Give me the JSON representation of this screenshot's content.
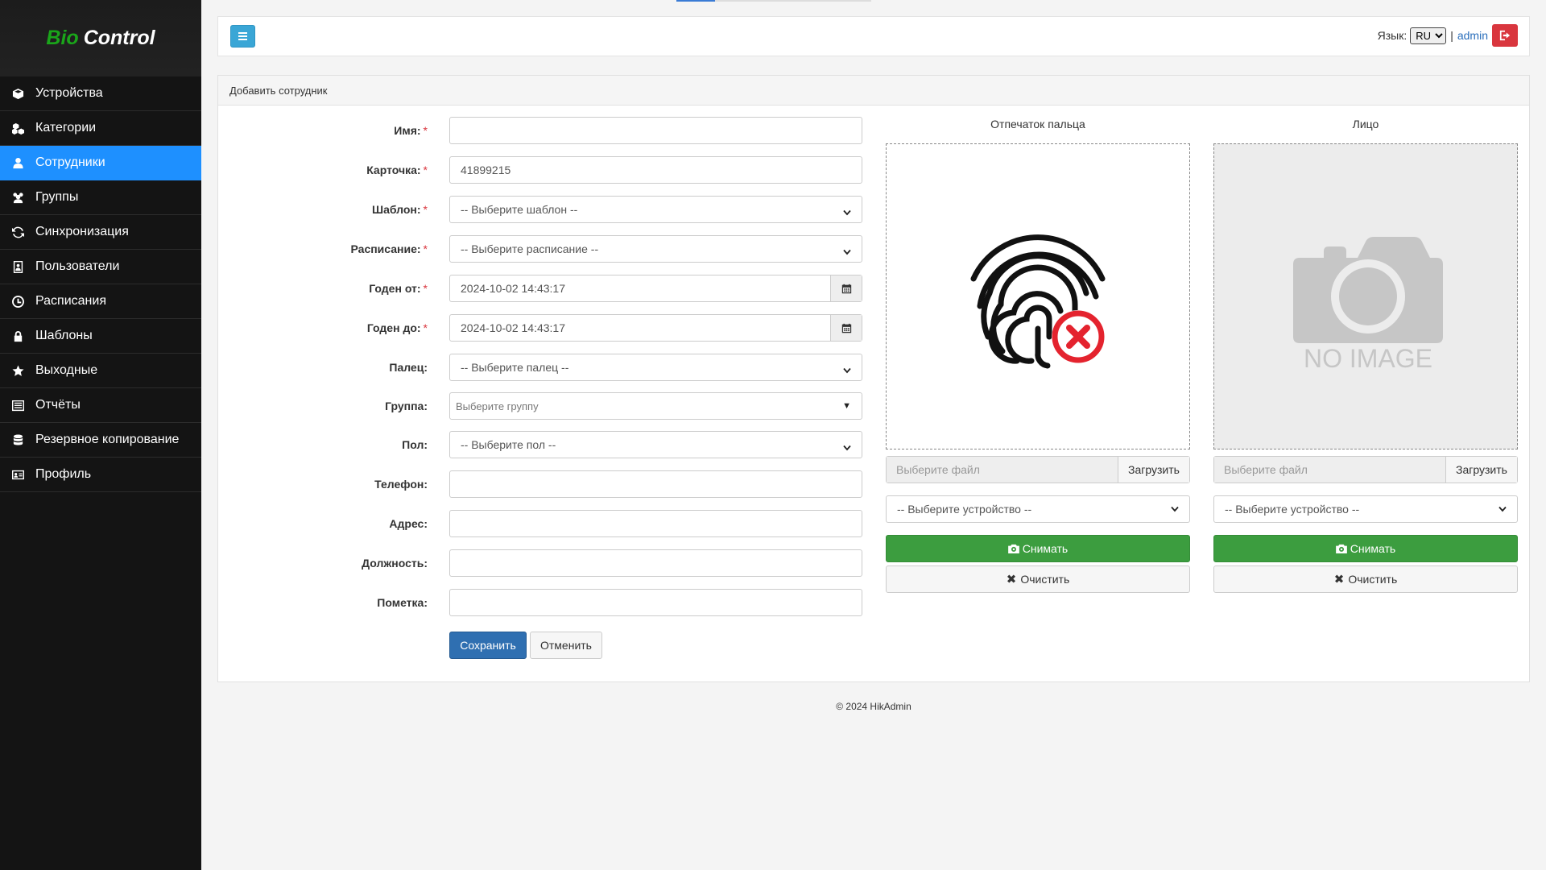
{
  "brand": {
    "part1": "Bio",
    "part2": "Control"
  },
  "sidebar": {
    "items": [
      {
        "label": "Устройства",
        "icon": "cube-icon",
        "active": false
      },
      {
        "label": "Категории",
        "icon": "cubes-icon",
        "active": false
      },
      {
        "label": "Сотрудники",
        "icon": "user-icon",
        "active": true
      },
      {
        "label": "Группы",
        "icon": "users-icon",
        "active": false
      },
      {
        "label": "Синхронизация",
        "icon": "refresh-icon",
        "active": false
      },
      {
        "label": "Пользователи",
        "icon": "user-card-icon",
        "active": false
      },
      {
        "label": "Расписания",
        "icon": "clock-icon",
        "active": false
      },
      {
        "label": "Шаблоны",
        "icon": "lock-icon",
        "active": false
      },
      {
        "label": "Выходные",
        "icon": "star-icon",
        "active": false
      },
      {
        "label": "Отчёты",
        "icon": "list-icon",
        "active": false
      },
      {
        "label": "Резервное копирование",
        "icon": "database-icon",
        "active": false
      },
      {
        "label": "Профиль",
        "icon": "id-card-icon",
        "active": false
      }
    ]
  },
  "topbar": {
    "lang_label": "Язык:",
    "lang_value": "RU",
    "separator": "|",
    "user": "admin"
  },
  "panel": {
    "title": "Добавить сотрудник"
  },
  "form": {
    "name": {
      "label": "Имя:",
      "value": ""
    },
    "card": {
      "label": "Карточка:",
      "value": "41899215"
    },
    "template": {
      "label": "Шаблон:",
      "value": "-- Выберите шаблон --"
    },
    "schedule": {
      "label": "Расписание:",
      "value": "-- Выберите расписание --"
    },
    "valid_from": {
      "label": "Годен от:",
      "value": "2024-10-02 14:43:17"
    },
    "valid_to": {
      "label": "Годен до:",
      "value": "2024-10-02 14:43:17"
    },
    "finger": {
      "label": "Палец:",
      "value": "-- Выберите палец --"
    },
    "group": {
      "label": "Группа:",
      "placeholder": "Выберите группу"
    },
    "gender": {
      "label": "Пол:",
      "value": "-- Выберите пол --"
    },
    "phone": {
      "label": "Телефон:",
      "value": ""
    },
    "address": {
      "label": "Адрес:",
      "value": ""
    },
    "position": {
      "label": "Должность:",
      "value": ""
    },
    "note": {
      "label": "Пометка:",
      "value": ""
    },
    "required_mark": "*",
    "save_label": "Сохранить",
    "cancel_label": "Отменить"
  },
  "fingerprint": {
    "title": "Отпечаток пальца",
    "file_placeholder": "Выберите файл",
    "upload_label": "Загрузить",
    "device_select": "-- Выберите устройство --",
    "capture_label": "Снимать",
    "clear_label": "Очистить"
  },
  "face": {
    "title": "Лицо",
    "no_image_text": "NO IMAGE",
    "file_placeholder": "Выберите файл",
    "upload_label": "Загрузить",
    "device_select": "-- Выберите устройство --",
    "capture_label": "Снимать",
    "clear_label": "Очистить"
  },
  "footer": {
    "text": "© 2024 HikAdmin"
  },
  "colors": {
    "sidebar_bg": "#141414",
    "active_item": "#1e90ff",
    "brand_green": "#1aa51a",
    "primary_button": "#2f6fb1",
    "success_button": "#3c9d3f",
    "danger_button": "#d9363e",
    "toggle_button": "#3aa6d6"
  }
}
